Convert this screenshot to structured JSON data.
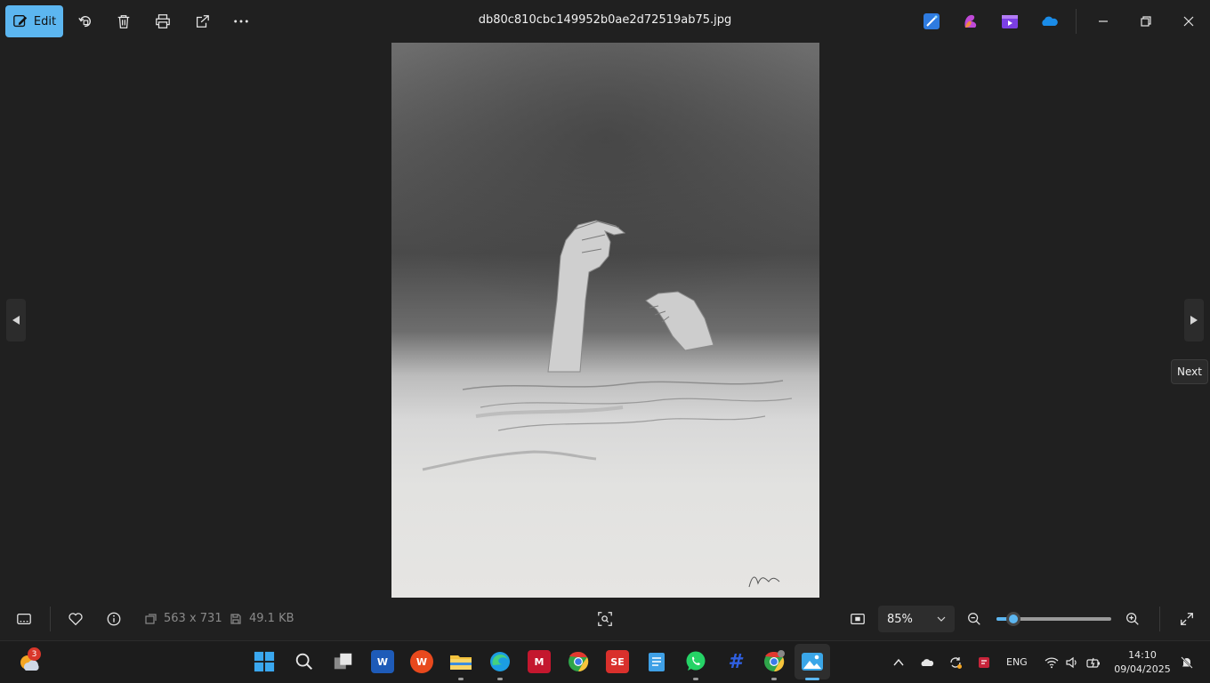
{
  "toolbar": {
    "edit_label": "Edit",
    "file_title": "db80c810cbc149952b0ae2d72519ab75.jpg"
  },
  "viewer": {
    "tooltip_next": "Next"
  },
  "bottom": {
    "dimensions": "563 x 731",
    "file_size": "49.1 KB",
    "zoom_value": "85%",
    "zoom_fraction": 0.15
  },
  "taskbar": {
    "weather_badge": "3",
    "language": "ENG",
    "time": "14:10",
    "date": "09/04/2025"
  },
  "colors": {
    "accent": "#5cb6f0",
    "background": "#202020"
  }
}
